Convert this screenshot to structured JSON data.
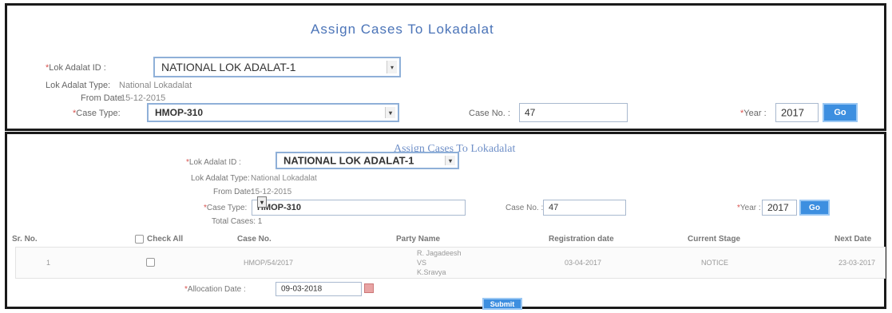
{
  "top_panel": {
    "title": "Assign Cases To Lokadalat",
    "lok_adalat_id_label": "Lok Adalat ID :",
    "lok_adalat_id_value": "NATIONAL LOK ADALAT-1",
    "lok_adalat_type_label": "Lok Adalat Type:",
    "lok_adalat_type_value": "National Lokadalat",
    "from_date_label": "From Date:",
    "from_date_value": "15-12-2015",
    "case_type_label": "Case Type:",
    "case_type_value": "HMOP-310",
    "case_no_label": "Case No. :",
    "case_no_value": "47",
    "year_label": "Year :",
    "year_value": "2017",
    "go_label": "Go"
  },
  "bottom_panel": {
    "title": "Assign Cases To Lokadalat",
    "lok_adalat_id_label": "Lok Adalat ID :",
    "lok_adalat_id_value": "NATIONAL LOK ADALAT-1",
    "lok_adalat_type_label": "Lok Adalat Type:",
    "lok_adalat_type_value": "National Lokadalat",
    "from_date_label": "From Date:",
    "from_date_value": "15-12-2015",
    "case_type_label": "Case Type:",
    "case_type_value": "HMOP-310",
    "case_no_label": "Case No. :",
    "case_no_value": "47",
    "year_label": "Year :",
    "year_value": "2017",
    "go_label": "Go",
    "total_cases_label": "Total Cases: 1",
    "table": {
      "headers": [
        "Sr. No.",
        "Check All",
        "Case No.",
        "Party Name",
        "Registration date",
        "Current Stage",
        "Next Date"
      ],
      "rows": [
        {
          "sr_no": "1",
          "case_no": "HMOP/54/2017",
          "party_name_line1": "R. Jagadeesh",
          "party_name_line2": "VS",
          "party_name_line3": "K.Sravya",
          "registration_date": "03-04-2017",
          "current_stage": "NOTICE",
          "next_date": "23-03-2017"
        }
      ]
    },
    "allocation_date_label": "Allocation Date :",
    "allocation_date_value": "09-03-2018",
    "submit_label": "Submit"
  },
  "colors": {
    "title_blue": "#4b74b8",
    "button_blue": "#3d8fe0",
    "required_red": "#d9534f"
  }
}
